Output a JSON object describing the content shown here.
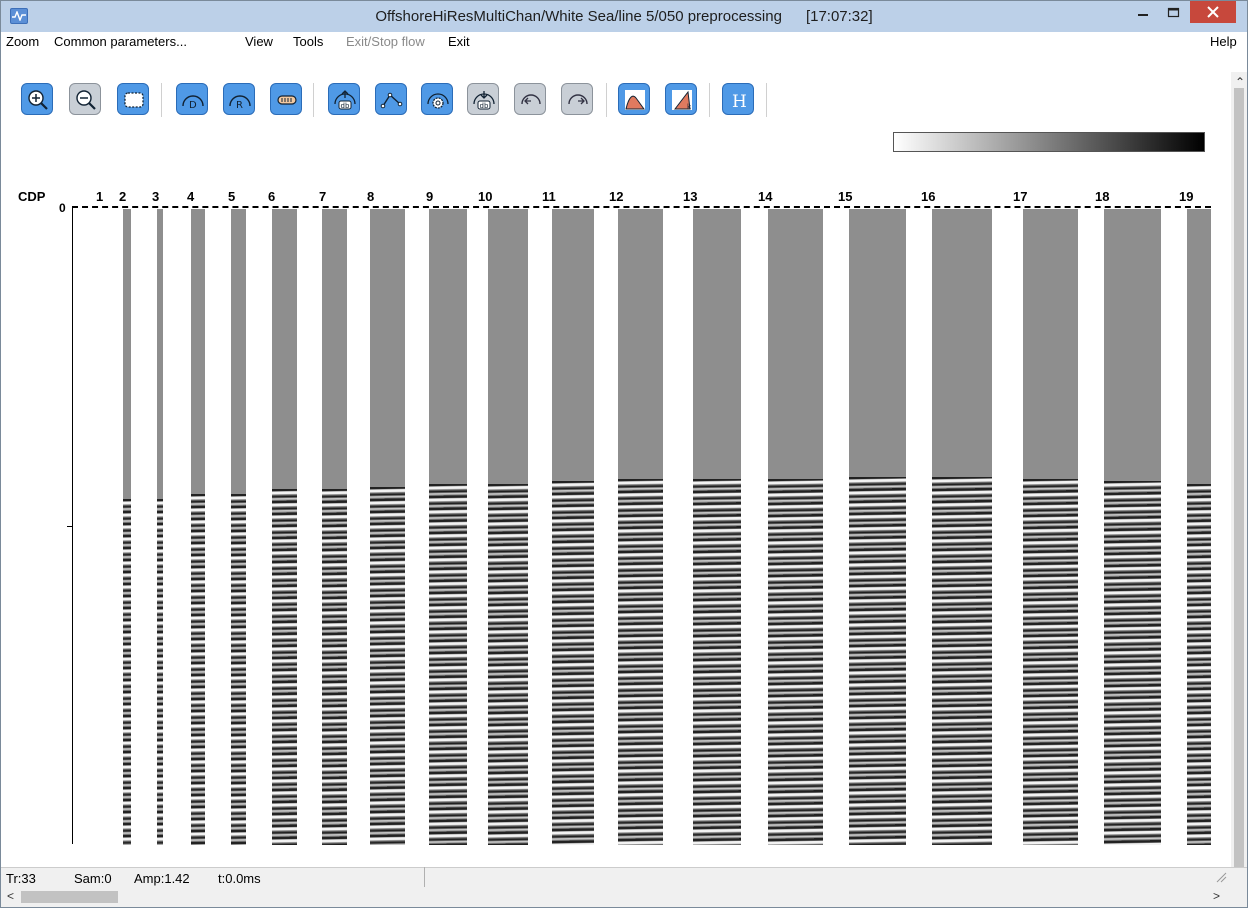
{
  "window": {
    "title": "OffshoreHiResMultiChan/White Sea/line 5/050 preprocessing",
    "clock": "[17:07:32]"
  },
  "menu": {
    "zoom": "Zoom",
    "common_parameters": "Common parameters...",
    "view": "View",
    "tools": "Tools",
    "exit_stop_flow": "Exit/Stop flow",
    "exit": "Exit",
    "help": "Help"
  },
  "toolbar": {
    "buttons": [
      {
        "icon": "zoom-in-icon"
      },
      {
        "icon": "zoom-out-icon"
      },
      {
        "icon": "fit-view-icon"
      },
      {
        "icon": "d-icon",
        "label": "D"
      },
      {
        "icon": "r-icon",
        "label": "R"
      },
      {
        "icon": "gain-icon"
      },
      {
        "icon": "db-up-icon",
        "label": "db"
      },
      {
        "icon": "picking-icon"
      },
      {
        "icon": "settings-db-icon"
      },
      {
        "icon": "db-down-icon",
        "label": "db"
      },
      {
        "icon": "undo-icon"
      },
      {
        "icon": "redo-icon"
      },
      {
        "icon": "spectrum-icon"
      },
      {
        "icon": "fk-icon",
        "label": "k"
      },
      {
        "icon": "header-icon",
        "label": "H"
      }
    ]
  },
  "plot": {
    "axis_label": "CDP",
    "time_zero": "0",
    "cdp_numbers": [
      "1",
      "2",
      "3",
      "4",
      "5",
      "6",
      "7",
      "8",
      "9",
      "10",
      "11",
      "12",
      "13",
      "14",
      "15",
      "16",
      "17",
      "18",
      "19"
    ]
  },
  "status": {
    "trace": "Tr:33",
    "sample": "Sam:0",
    "amplitude": "Amp:1.42",
    "time": "t:0.0ms"
  },
  "colors": {
    "title_bar": "#bcd0e8",
    "close_button": "#c7483c",
    "button_blue": "#4f99e6"
  }
}
